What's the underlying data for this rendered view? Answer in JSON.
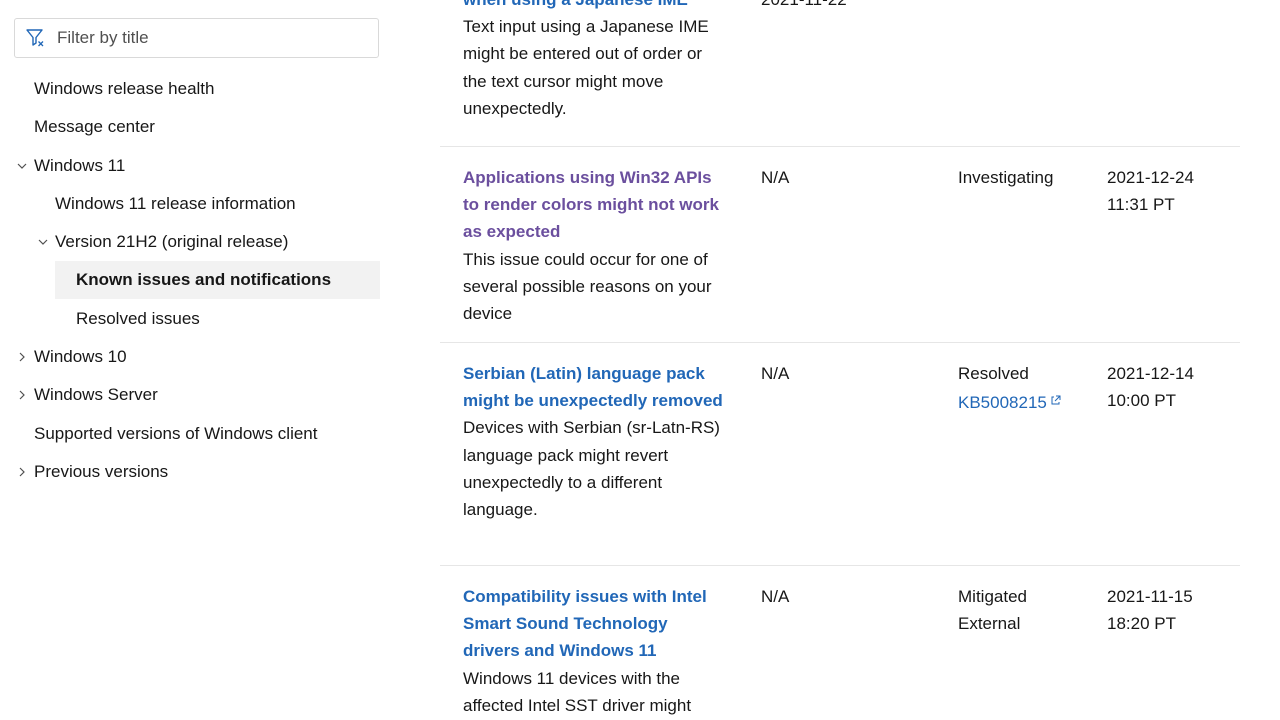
{
  "sidebar": {
    "filter": {
      "placeholder": "Filter by title",
      "icon": "filter-icon"
    },
    "items": [
      {
        "label": "Windows release health",
        "level": 0
      },
      {
        "label": "Message center",
        "level": 0
      },
      {
        "label": "Windows 11",
        "level": 0,
        "chevron": "down"
      },
      {
        "label": "Windows 11 release information",
        "level": 1
      },
      {
        "label": "Version 21H2 (original release)",
        "level": 1,
        "chevron": "down"
      },
      {
        "label": "Known issues and notifications",
        "level": 2,
        "selected": true
      },
      {
        "label": "Resolved issues",
        "level": 2
      },
      {
        "label": "Windows 10",
        "level": 0,
        "chevron": "right"
      },
      {
        "label": "Windows Server",
        "level": 0,
        "chevron": "right"
      },
      {
        "label": "Supported versions of Windows client",
        "level": 0
      },
      {
        "label": "Previous versions",
        "level": 0,
        "chevron": "right"
      }
    ]
  },
  "issues": [
    {
      "title": "when using a Japanese IME",
      "description": "Text input using a Japanese IME might be entered out of order or the text cursor might move unexpectedly.",
      "originating": "2021-11-22",
      "status": "",
      "status_link": "",
      "status_extra": "",
      "date": "",
      "time": ""
    },
    {
      "title": "Applications using Win32 APIs to render colors might not work as expected",
      "description": "This issue could occur for one of several possible reasons on your device",
      "originating": "N/A",
      "status": "Investigating",
      "status_link": "",
      "status_extra": "",
      "date": "2021-12-24",
      "time": "11:31 PT",
      "visited": true
    },
    {
      "title": "Serbian (Latin) language pack might be unexpectedly removed",
      "description": "Devices with Serbian (sr-Latn-RS) language pack might revert unexpectedly to a different language.",
      "originating": "N/A",
      "status": "Resolved",
      "status_link": "KB5008215",
      "status_extra": "",
      "date": "2021-12-14",
      "time": "10:00 PT"
    },
    {
      "title": "Compatibility issues with Intel Smart Sound Technology drivers and Windows 11",
      "description": "Windows 11 devices with the affected Intel SST driver might",
      "originating": "N/A",
      "status": "Mitigated",
      "status_link": "",
      "status_extra": "External",
      "date": "2021-11-15",
      "time": "18:20 PT"
    }
  ],
  "colors": {
    "link": "#2167b7",
    "visited_link": "#6b4f9e",
    "selected_bg": "#f2f2f2",
    "separator": "#e6e6e6"
  }
}
